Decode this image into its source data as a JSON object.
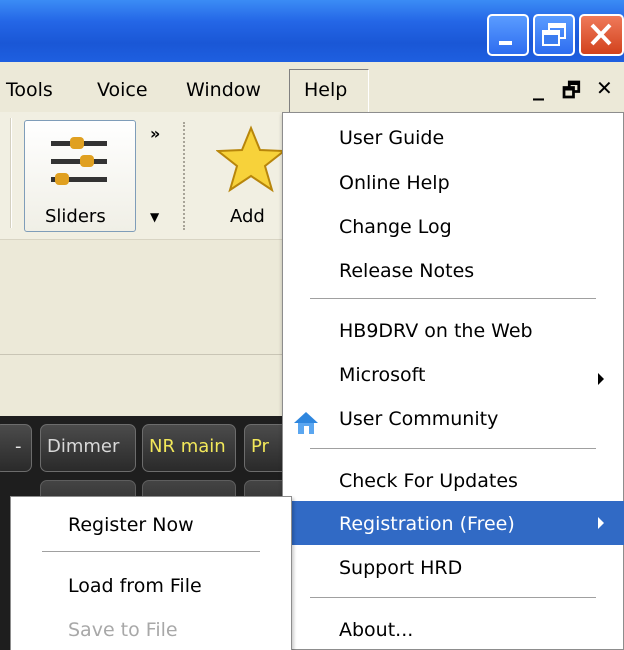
{
  "menubar": {
    "items": [
      "Tools",
      "Voice",
      "Window",
      "Help"
    ],
    "mdi_controls": [
      "_",
      "🗗",
      "✕"
    ]
  },
  "toolbar": {
    "chevron": "»",
    "sliders_label": "Sliders",
    "add_label": "Add"
  },
  "darkstrip": {
    "buttons": [
      {
        "label": "-",
        "color": "#e8e8e8"
      },
      {
        "label": "Dimmer",
        "color": "#d8d8d8"
      },
      {
        "label": "NR main",
        "color": "#f2e85a"
      },
      {
        "label": "Pr",
        "color": "#f2e85a"
      }
    ]
  },
  "help_menu": {
    "groups": [
      [
        "User Guide",
        "Online Help",
        "Change Log",
        "Release Notes"
      ],
      [
        "HB9DRV on the Web",
        "Microsoft",
        "User Community"
      ],
      [
        "Check For Updates",
        "Registration (Free)",
        "Support HRD"
      ],
      [
        "About..."
      ]
    ],
    "selected": "Registration (Free)",
    "selection_color": "#316ac5"
  },
  "registration_submenu": {
    "items": [
      "Register Now",
      "Load from File",
      "Save to File"
    ],
    "disabled": [
      "Save to File"
    ]
  },
  "icons": [
    "minimize-icon",
    "restore-icon",
    "close-icon",
    "sliders-icon",
    "star-icon",
    "home-icon",
    "submenu-arrow-icon"
  ]
}
